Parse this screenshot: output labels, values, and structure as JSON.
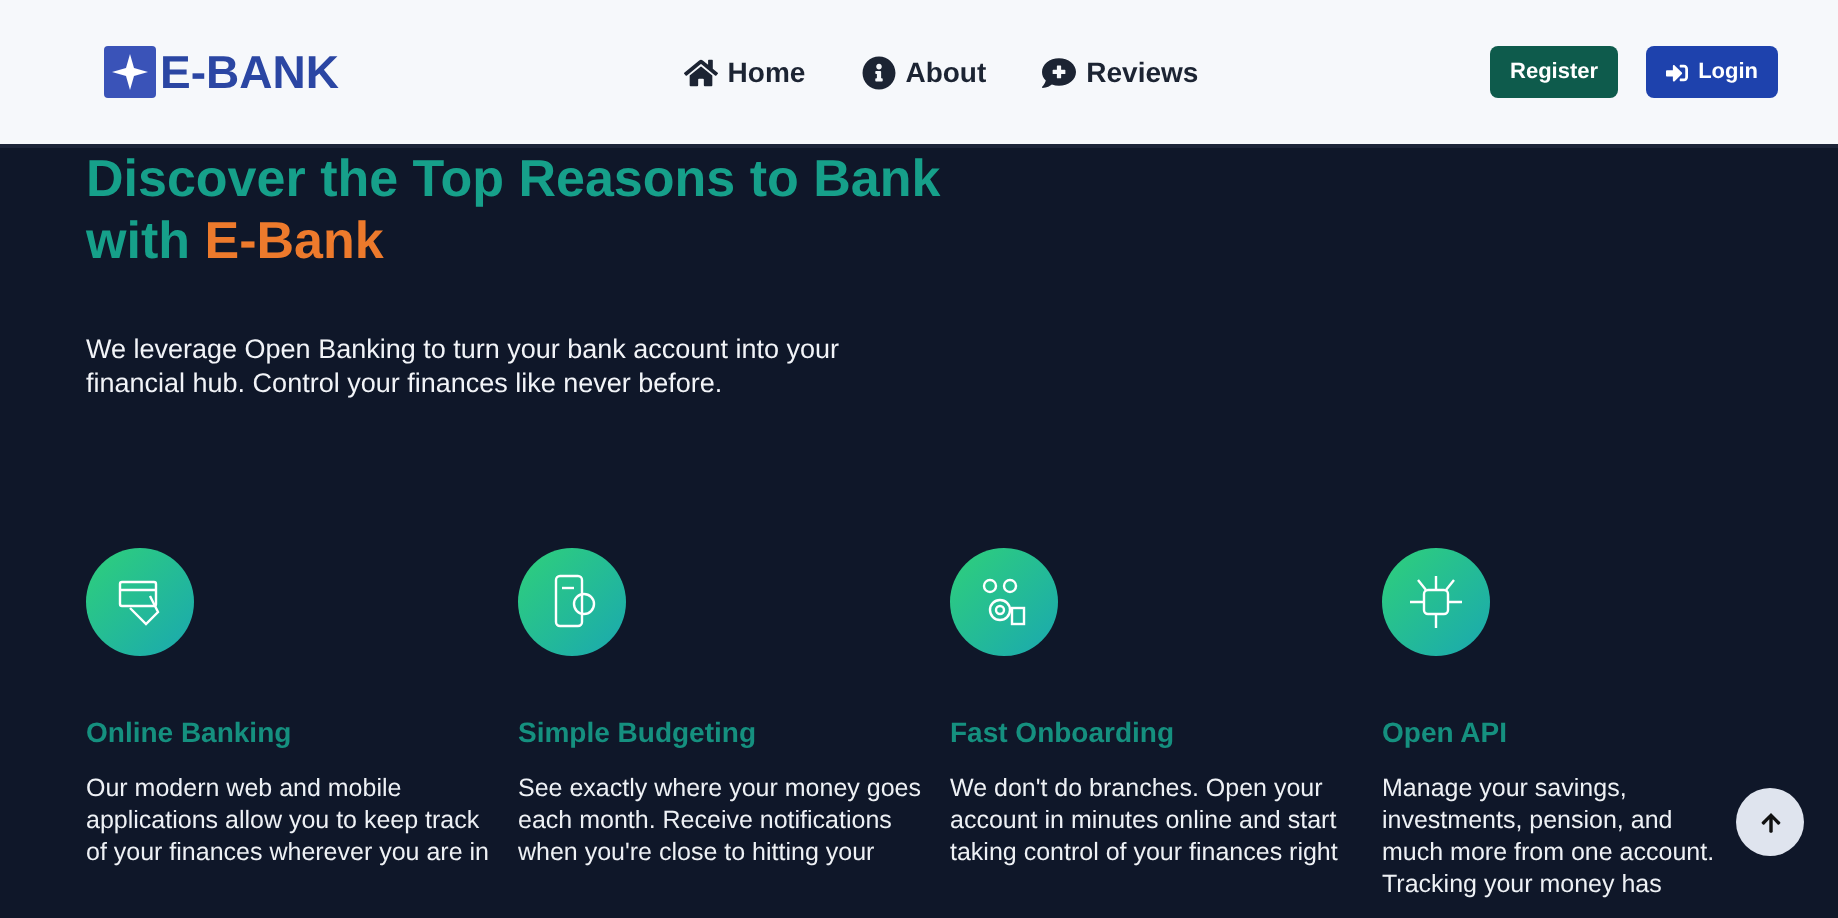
{
  "navbar": {
    "logo": "E-BANK",
    "links": [
      {
        "label": "Home"
      },
      {
        "label": "About"
      },
      {
        "label": "Reviews"
      }
    ],
    "buttons": [
      {
        "label": "Register",
        "kind": "register"
      },
      {
        "label": "Login",
        "kind": "login"
      }
    ]
  },
  "hero": {
    "heading": {
      "lead": "Discover the Top Reasons to Bank with",
      "highlight": "E-Bank"
    },
    "text": "We leverage Open Banking to turn your bank account into your financial hub. Control your finances like never before."
  },
  "features": [
    {
      "title": "Online Banking",
      "text": "Our modern web and mobile applications allow you to keep track of your finances wherever you are in"
    },
    {
      "title": "Simple Budgeting",
      "text": "See exactly where your money goes each month. Receive notifications when you're close to hitting your"
    },
    {
      "title": "Fast Onboarding",
      "text": "We don't do branches. Open your account in minutes online and start taking control of your finances right"
    },
    {
      "title": "Open API",
      "text": "Manage your savings, investments, pension, and much more from one account. Tracking your money has"
    }
  ]
}
